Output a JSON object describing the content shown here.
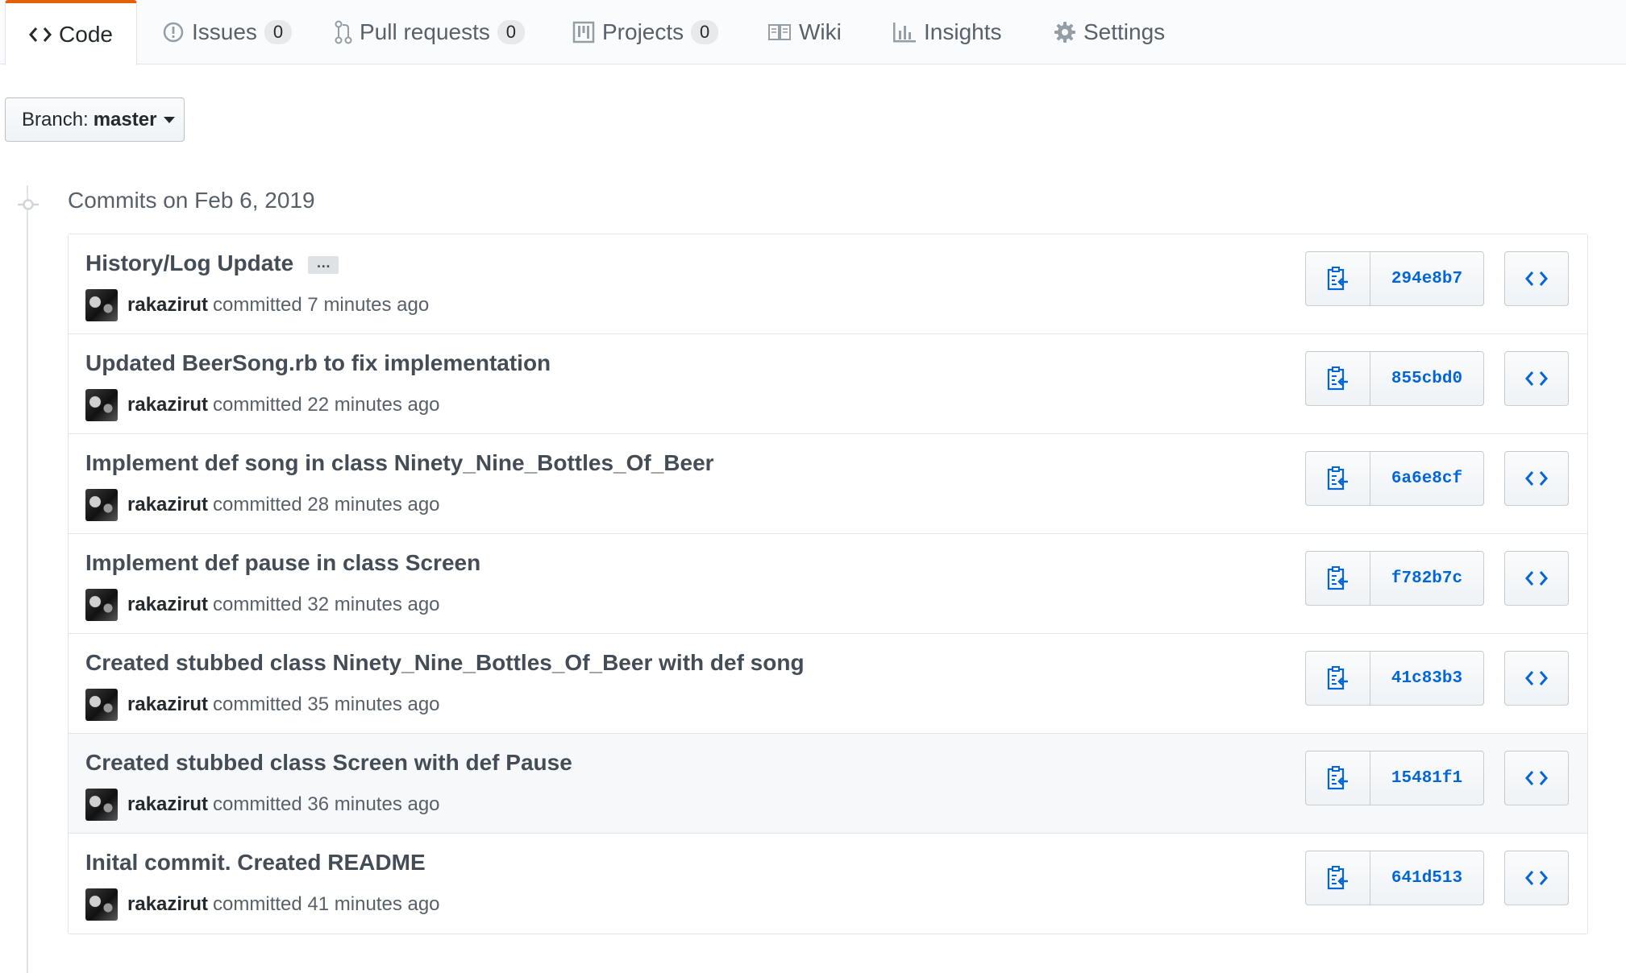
{
  "tabs": [
    {
      "label": "Code",
      "icon": "code-icon"
    },
    {
      "label": "Issues",
      "icon": "issue-opened-icon",
      "count": "0"
    },
    {
      "label": "Pull requests",
      "icon": "git-pull-request-icon",
      "count": "0"
    },
    {
      "label": "Projects",
      "icon": "project-icon",
      "count": "0"
    },
    {
      "label": "Wiki",
      "icon": "book-icon"
    },
    {
      "label": "Insights",
      "icon": "graph-icon"
    },
    {
      "label": "Settings",
      "icon": "gear-icon"
    }
  ],
  "branch": {
    "prefix": "Branch:",
    "name": "master"
  },
  "commits_header": "Commits on Feb 6, 2019",
  "commits": [
    {
      "message": "History/Log Update",
      "has_ellipsis": true,
      "ellipsis": "…",
      "author": "rakazirut",
      "verb": "committed",
      "time": "7 minutes ago",
      "sha": "294e8b7"
    },
    {
      "message": "Updated BeerSong.rb to fix implementation",
      "author": "rakazirut",
      "verb": "committed",
      "time": "22 minutes ago",
      "sha": "855cbd0"
    },
    {
      "message": "Implement def song in class Ninety_Nine_Bottles_Of_Beer",
      "author": "rakazirut",
      "verb": "committed",
      "time": "28 minutes ago",
      "sha": "6a6e8cf"
    },
    {
      "message": "Implement def pause in class Screen",
      "author": "rakazirut",
      "verb": "committed",
      "time": "32 minutes ago",
      "sha": "f782b7c"
    },
    {
      "message": "Created stubbed class Ninety_Nine_Bottles_Of_Beer with def song",
      "author": "rakazirut",
      "verb": "committed",
      "time": "35 minutes ago",
      "sha": "41c83b3"
    },
    {
      "message": "Created stubbed class Screen with def Pause",
      "author": "rakazirut",
      "verb": "committed",
      "time": "36 minutes ago",
      "sha": "15481f1",
      "highlighted": true
    },
    {
      "message": "Inital commit. Created README",
      "author": "rakazirut",
      "verb": "committed",
      "time": "41 minutes ago",
      "sha": "641d513"
    }
  ],
  "colors": {
    "accent": "#e36209",
    "link": "#0366d6",
    "highlight": "#f6f8fa"
  }
}
